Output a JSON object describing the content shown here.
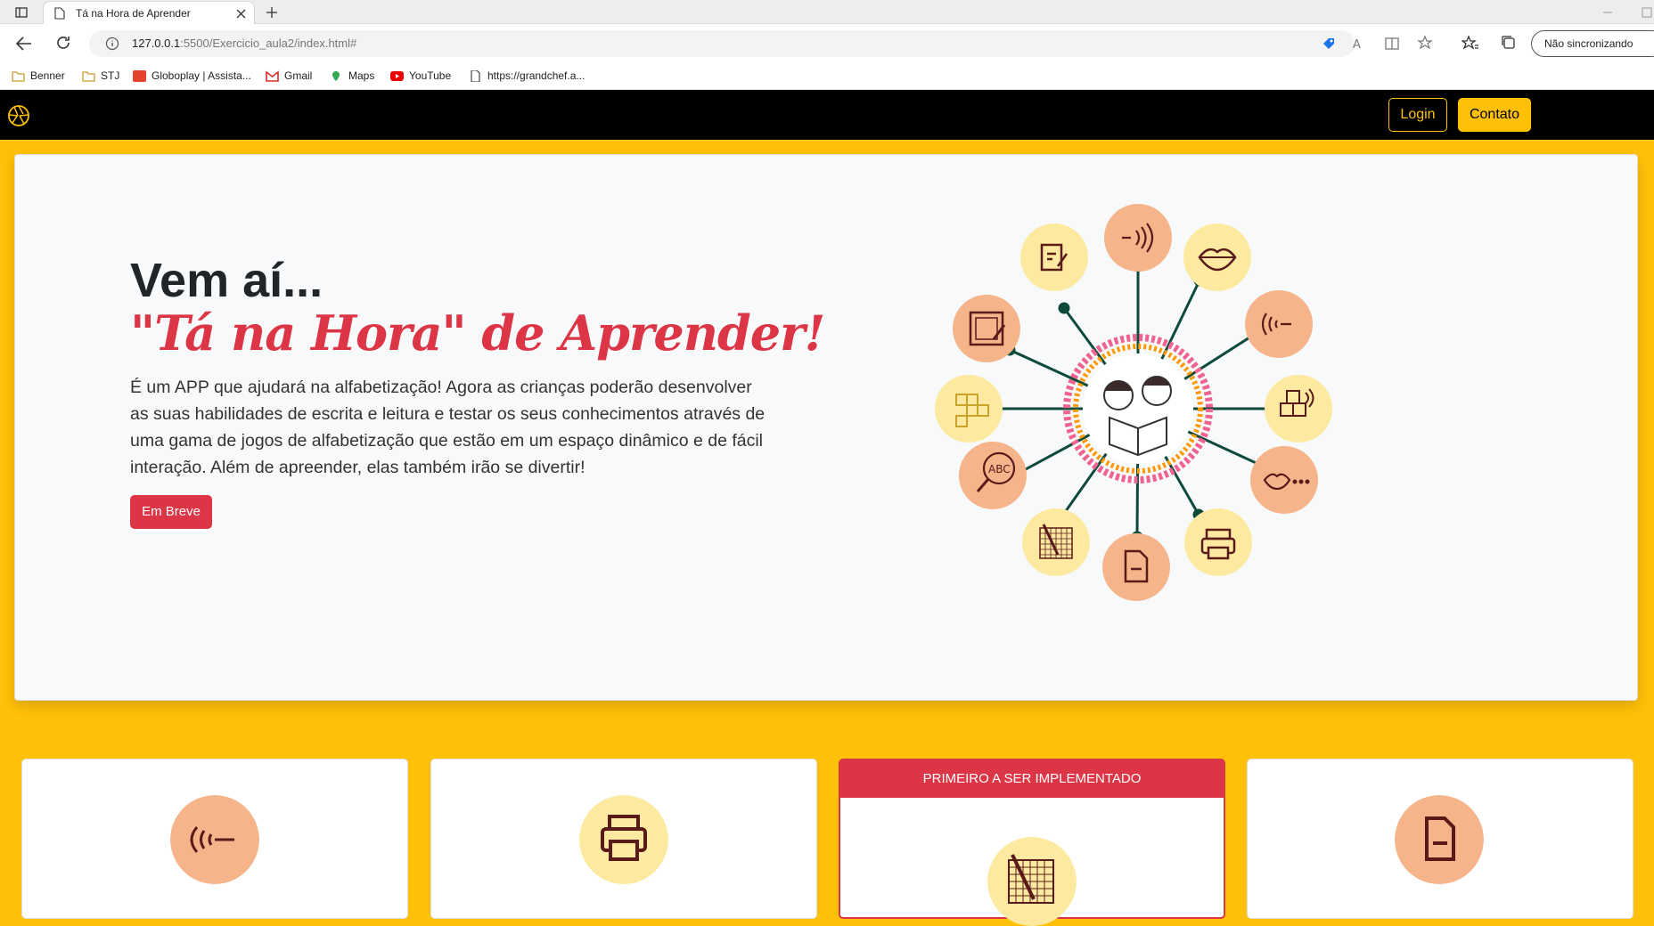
{
  "browser": {
    "tab_title": "Tá na Hora de Aprender",
    "url_host": "127.0.0.1",
    "url_path": ":5500/Exercicio_aula2/index.html#",
    "sync_label": "Não sincronizando",
    "bookmarks": [
      "Benner",
      "STJ",
      "Globoplay | Assista...",
      "Gmail",
      "Maps",
      "YouTube",
      "https://grandchef.a..."
    ]
  },
  "navbar": {
    "login_label": "Login",
    "contato_label": "Contato"
  },
  "hero": {
    "title": "Vem aí...",
    "subtitle": "\"Tá na Hora\" de Aprender!",
    "paragraph": "É um APP que ajudará na alfabetização! Agora as crianças poderão desenvolver as suas habilidades de escrita e leitura e testar os seus conhecimentos através de uma gama de jogos de alfabetização que estão em um espaço dinâmico e de fácil interação. Além de apreender, elas também irão se divertir!",
    "button_label": "Em Breve"
  },
  "cards": [
    {
      "header": "",
      "icon": "hearing-icon"
    },
    {
      "header": "",
      "icon": "printer-icon"
    },
    {
      "header": "PRIMEIRO A SER IMPLEMENTADO",
      "icon": "crossword-pencil-icon"
    },
    {
      "header": "",
      "icon": "document-icon"
    }
  ],
  "colors": {
    "accent": "#ffc107",
    "danger": "#dc3545",
    "peach": "#f5b48a",
    "light_yellow": "#fdeaa0",
    "icon_stroke": "#5a1a1a",
    "spoke": "#0d4a3a"
  }
}
